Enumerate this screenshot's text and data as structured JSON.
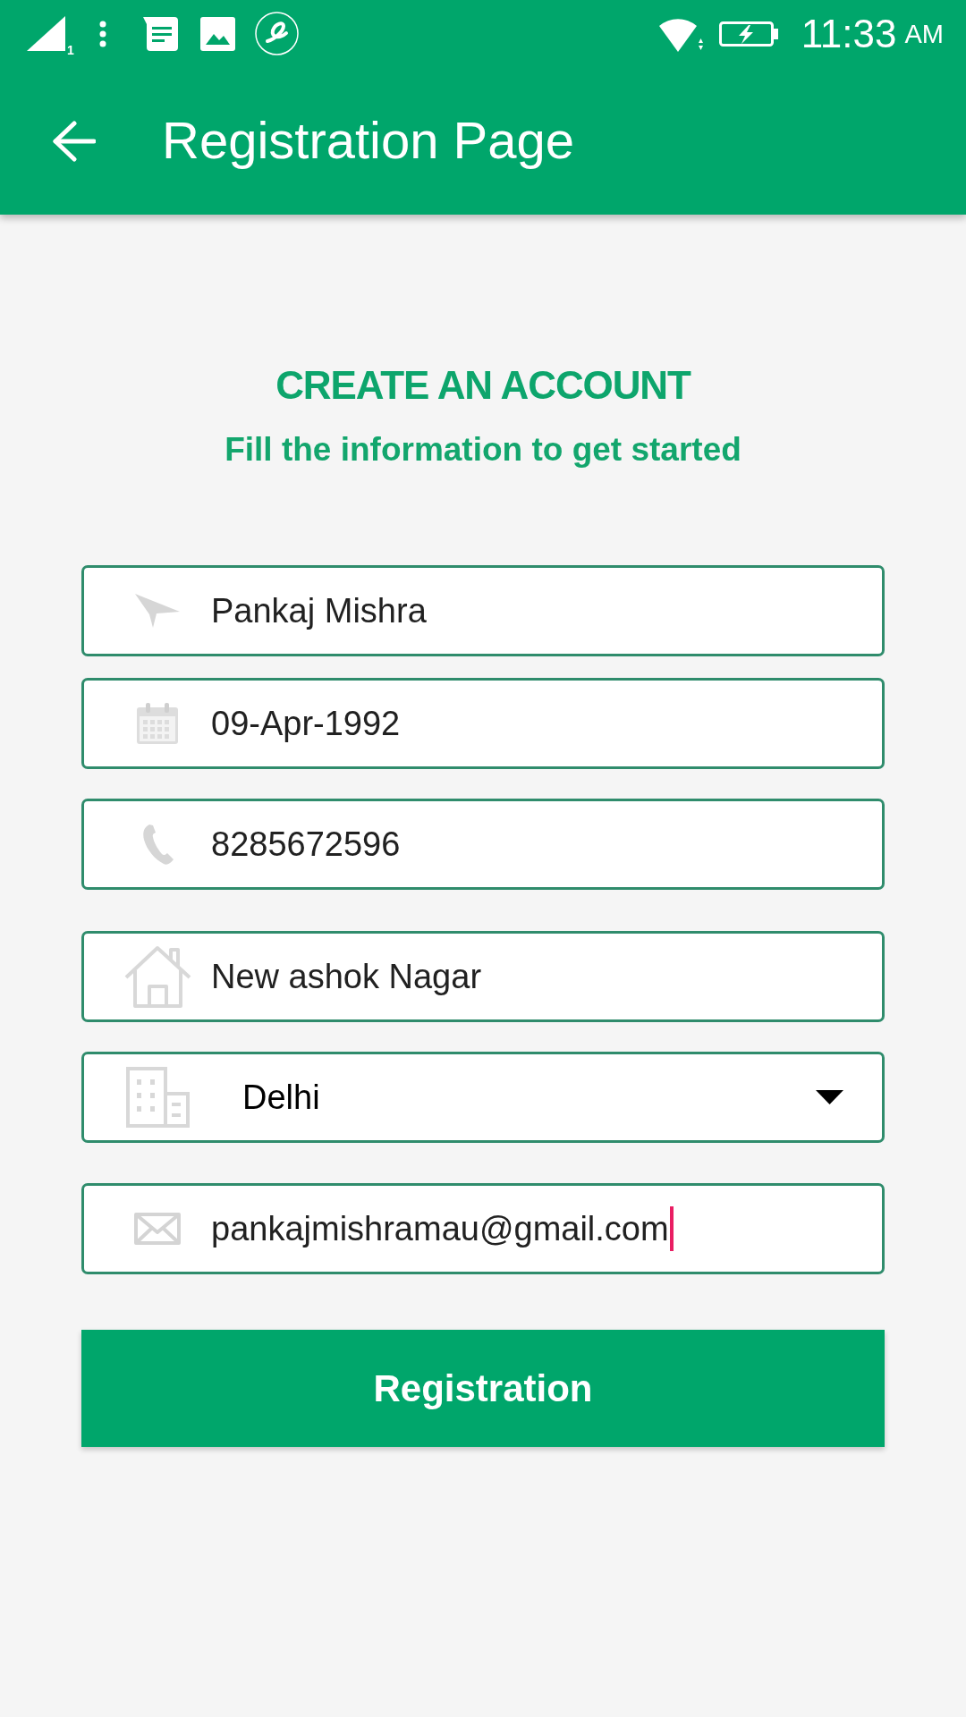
{
  "status_bar": {
    "sim_slot": "1",
    "time": "11:33",
    "am_pm": "AM"
  },
  "app_bar": {
    "title": "Registration Page"
  },
  "header": {
    "title": "CREATE AN ACCOUNT",
    "subtitle": "Fill the information to get started"
  },
  "fields": [
    {
      "kind": "text",
      "value": "Pankaj Mishra",
      "focused": false
    },
    {
      "kind": "text",
      "value": "09-Apr-1992",
      "focused": false
    },
    {
      "kind": "text",
      "value": "8285672596",
      "focused": false
    },
    {
      "kind": "text",
      "value": "New ashok Nagar",
      "focused": false
    },
    {
      "kind": "dropdown",
      "value": "Delhi",
      "focused": false
    },
    {
      "kind": "text",
      "value": "pankajmishramau@gmail.com",
      "focused": true
    }
  ],
  "button": {
    "label": "Registration"
  }
}
